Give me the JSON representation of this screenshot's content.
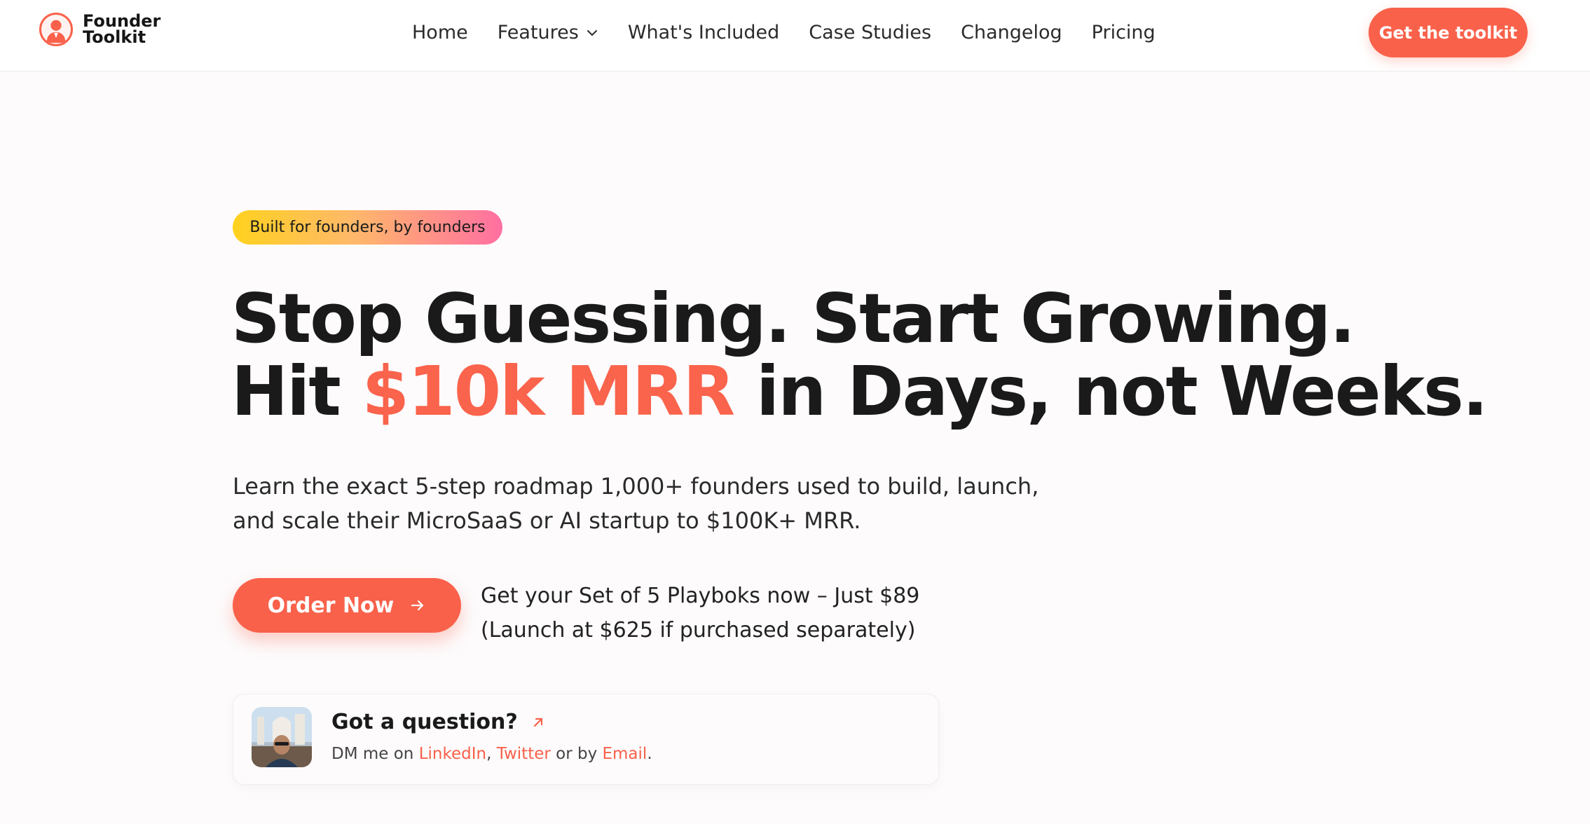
{
  "brand": {
    "line1": "Founder",
    "line2": "Toolkit",
    "logo_icon": "founder-avatar-icon",
    "accent_color": "#f9614a"
  },
  "nav": {
    "items": [
      {
        "label": "Home"
      },
      {
        "label": "Features",
        "icon": "chevron-down-icon"
      },
      {
        "label": "What's Included"
      },
      {
        "label": "Case Studies"
      },
      {
        "label": "Changelog"
      },
      {
        "label": "Pricing"
      }
    ],
    "cta_label": "Get the toolkit"
  },
  "hero": {
    "badge": "Built for founders, by founders",
    "headline_line1": "Stop Guessing. Start Growing.",
    "headline_line2_pre": "Hit ",
    "headline_line2_accent": "$10k MRR",
    "headline_line2_post": " in Days, not Weeks.",
    "subtext": "Learn the exact 5-step roadmap 1,000+ founders used to build, launch, and scale their MicroSaaS or AI startup to $100K+ MRR.",
    "order_label": "Order Now",
    "order_icon": "arrow-right-icon",
    "offer_line1": "Get your Set of 5 Playboks now – Just $89",
    "offer_line2": "(Launch at $625 if purchased separately)"
  },
  "question": {
    "title": "Got a question?",
    "title_icon": "arrow-up-right-icon",
    "prefix": "DM me on ",
    "link1": "LinkedIn",
    "sep1": ", ",
    "link2": "Twitter",
    "sep2": " or by ",
    "link3": "Email",
    "suffix": ".",
    "avatar_icon": "founder-photo-avatar"
  }
}
